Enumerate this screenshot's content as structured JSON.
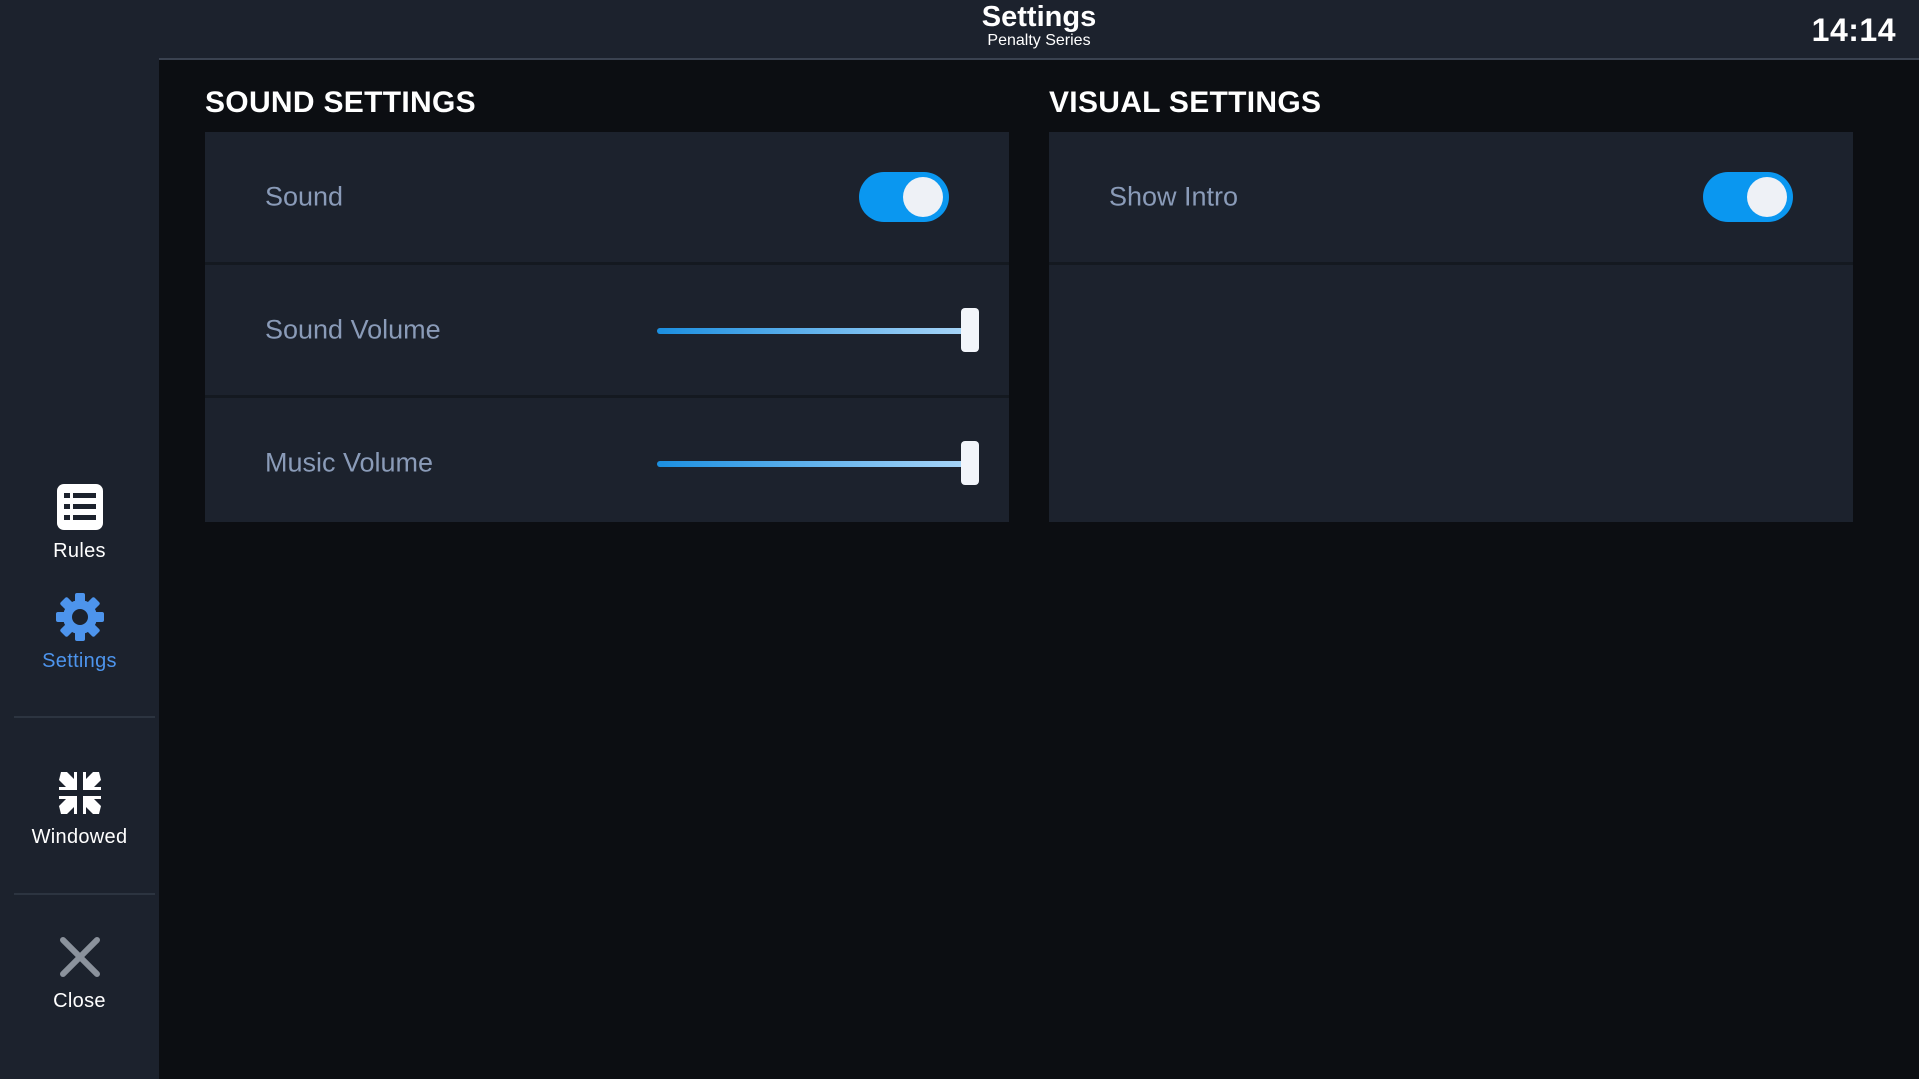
{
  "header": {
    "title": "Settings",
    "subtitle": "Penalty Series",
    "clock": "14:14"
  },
  "sidebar": {
    "items": [
      {
        "label": "Rules",
        "icon": "list-icon"
      },
      {
        "label": "Settings",
        "icon": "gear-icon",
        "active": true
      },
      {
        "label": "Windowed",
        "icon": "windowed-arrows-icon"
      },
      {
        "label": "Close",
        "icon": "close-icon"
      }
    ]
  },
  "sound_settings": {
    "title": "SOUND SETTINGS",
    "sound_label": "Sound",
    "sound_enabled": true,
    "sound_volume_label": "Sound Volume",
    "sound_volume": 1.0,
    "music_volume_label": "Music Volume",
    "music_volume": 1.0
  },
  "visual_settings": {
    "title": "VISUAL SETTINGS",
    "show_intro_label": "Show Intro",
    "show_intro_enabled": true
  },
  "colors": {
    "accent": "#0a97f0",
    "active_nav": "#4d94ec",
    "panel": "#1c222d",
    "background": "#0c0e12",
    "label_text": "#8a9bb8"
  }
}
